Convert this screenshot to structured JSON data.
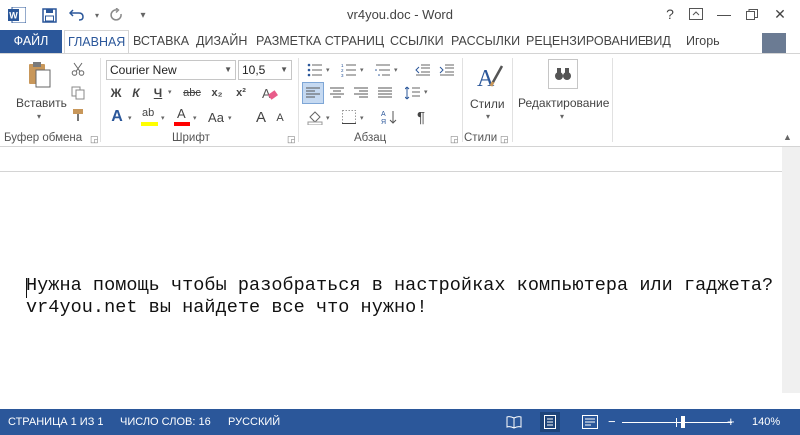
{
  "window": {
    "title": "vr4you.doc - Word",
    "help": "?",
    "minimize": "—",
    "close": "✕"
  },
  "tabs": [
    {
      "label": "ФАЙЛ"
    },
    {
      "label": "ГЛАВНАЯ"
    },
    {
      "label": "ВСТАВКА"
    },
    {
      "label": "ДИЗАЙН"
    },
    {
      "label": "РАЗМЕТКА СТРАНИЦ"
    },
    {
      "label": "ССЫЛКИ"
    },
    {
      "label": "РАССЫЛКИ"
    },
    {
      "label": "РЕЦЕНЗИРОВАНИЕ"
    },
    {
      "label": "ВИД"
    }
  ],
  "user": {
    "name": "Игорь"
  },
  "ribbon": {
    "clipboard": {
      "paste_label": "Вставить",
      "group_label": "Буфер обмена"
    },
    "font": {
      "family": "Courier New",
      "size": "10,5",
      "bold": "Ж",
      "italic": "К",
      "underline": "Ч",
      "strike": "abc",
      "subscript": "x₂",
      "superscript": "x²",
      "effects": "A",
      "highlight": "ab",
      "color": "A",
      "case": "Aa",
      "grow": "A",
      "shrink": "A",
      "group_label": "Шрифт"
    },
    "paragraph": {
      "pilcrow": "¶",
      "group_label": "Абзац"
    },
    "styles": {
      "label": "Стили",
      "group_label": "Стили"
    },
    "editing": {
      "label": "Редактирование"
    }
  },
  "document": {
    "line1": "Нужна помощь чтобы разобраться в настройках компьютера или гаджета?",
    "line2": "vr4you.net вы найдете все что нужно!"
  },
  "status": {
    "page": "СТРАНИЦА 1 ИЗ 1",
    "words": "ЧИСЛО СЛОВ: 16",
    "language": "РУССКИЙ",
    "zoom_minus": "−",
    "zoom_plus": "+",
    "zoom": "140%",
    "zoom_level_percent": 140
  },
  "colors": {
    "accent": "#2b579a",
    "highlight": "#ffff00",
    "font_color": "#ff0000"
  }
}
